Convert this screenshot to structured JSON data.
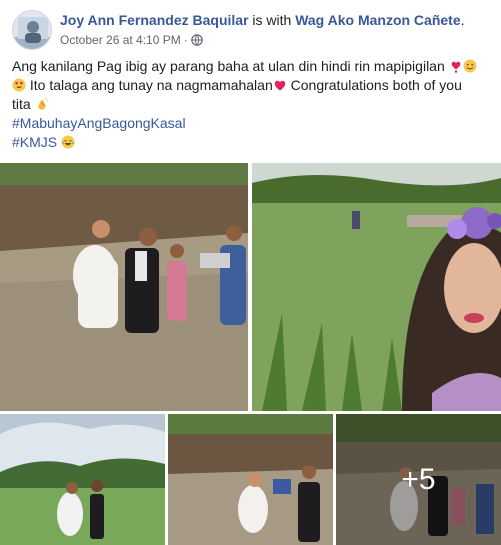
{
  "post": {
    "author": "Joy Ann Fernandez Baquilar",
    "with_text": " is with ",
    "tagged_person": "Wag Ako Manzon Cañete",
    "tagged_suffix": ".",
    "timestamp": "October 26 at 4:10 PM",
    "separator": "·",
    "audience_icon": "globe-icon",
    "caption": {
      "line1": "Ang kanilang Pag ibig ay parang baha at ulan din hindi rin mapipigilan",
      "line2": " Ito talaga ang tunay na nagmamahalan",
      "line2b": " Congratulations both of you",
      "line3": "tita",
      "hashtag1": "#MabuhayAngBagongKasal",
      "hashtag2": "#KMJS"
    },
    "emojis": [
      "heart-exclamation-icon",
      "smiling-face-icon",
      "heart-eyes-icon",
      "red-heart-icon",
      "clapping-hands-icon",
      "laughing-tears-icon"
    ],
    "photos": {
      "more_label": "+5"
    }
  },
  "colors": {
    "link": "#385898",
    "text": "#1c1e21",
    "meta": "#616770",
    "heart": "#e0245e"
  }
}
